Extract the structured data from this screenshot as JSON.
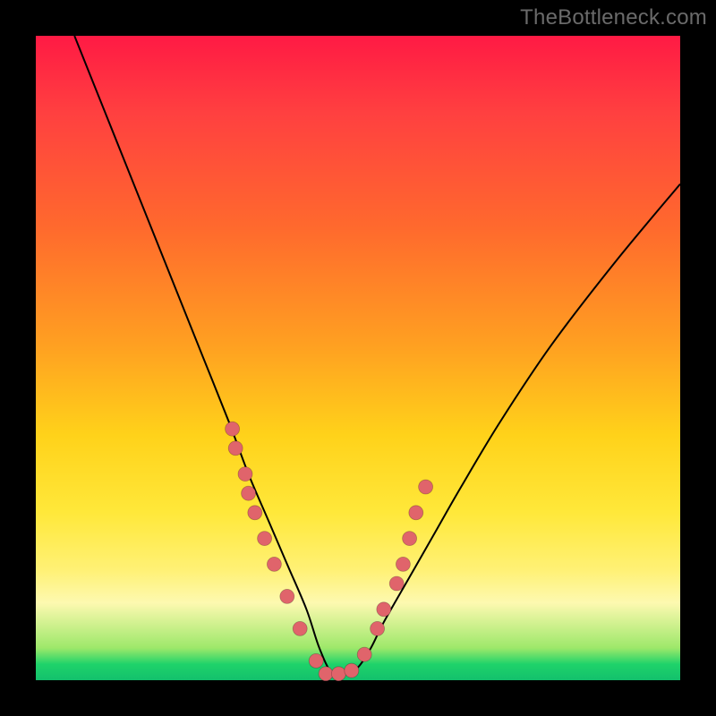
{
  "watermark": "TheBottleneck.com",
  "colors": {
    "background": "#000000",
    "gradient_top": "#ff1a44",
    "gradient_mid": "#ffd21a",
    "gradient_bottom": "#13c06c",
    "curve": "#000000",
    "dot": "#e0646b"
  },
  "chart_data": {
    "type": "line",
    "title": "",
    "xlabel": "",
    "ylabel": "",
    "xlim": [
      0,
      100
    ],
    "ylim": [
      0,
      100
    ],
    "grid": false,
    "note": "V-shaped bottleneck curve. x is normalized 0–100 across the plot width; y is normalized 0–100 where 0 is the bottom (green) and 100 is the top (red). Curve minimum (best match / zero bottleneck) occurs near x≈46 at y≈1.",
    "series": [
      {
        "name": "bottleneck-curve",
        "x": [
          6,
          10,
          14,
          18,
          22,
          26,
          30,
          33,
          36,
          39,
          42,
          44,
          46,
          48,
          50,
          52,
          54,
          58,
          62,
          66,
          72,
          80,
          90,
          100
        ],
        "y": [
          100,
          90,
          80,
          70,
          60,
          50,
          40,
          32,
          25,
          18,
          11,
          5,
          1,
          1,
          2,
          5,
          9,
          16,
          23,
          30,
          40,
          52,
          65,
          77
        ]
      }
    ],
    "points": {
      "name": "highlighted-dots",
      "note": "Salmon dots clustered around the curve's trough region on both branches.",
      "x": [
        30.5,
        31,
        32.5,
        33,
        34,
        35.5,
        37,
        39,
        41,
        43.5,
        45,
        47,
        49,
        51,
        53,
        54,
        56,
        57,
        58,
        59,
        60.5
      ],
      "y": [
        39,
        36,
        32,
        29,
        26,
        22,
        18,
        13,
        8,
        3,
        1,
        1,
        1.5,
        4,
        8,
        11,
        15,
        18,
        22,
        26,
        30
      ]
    }
  }
}
